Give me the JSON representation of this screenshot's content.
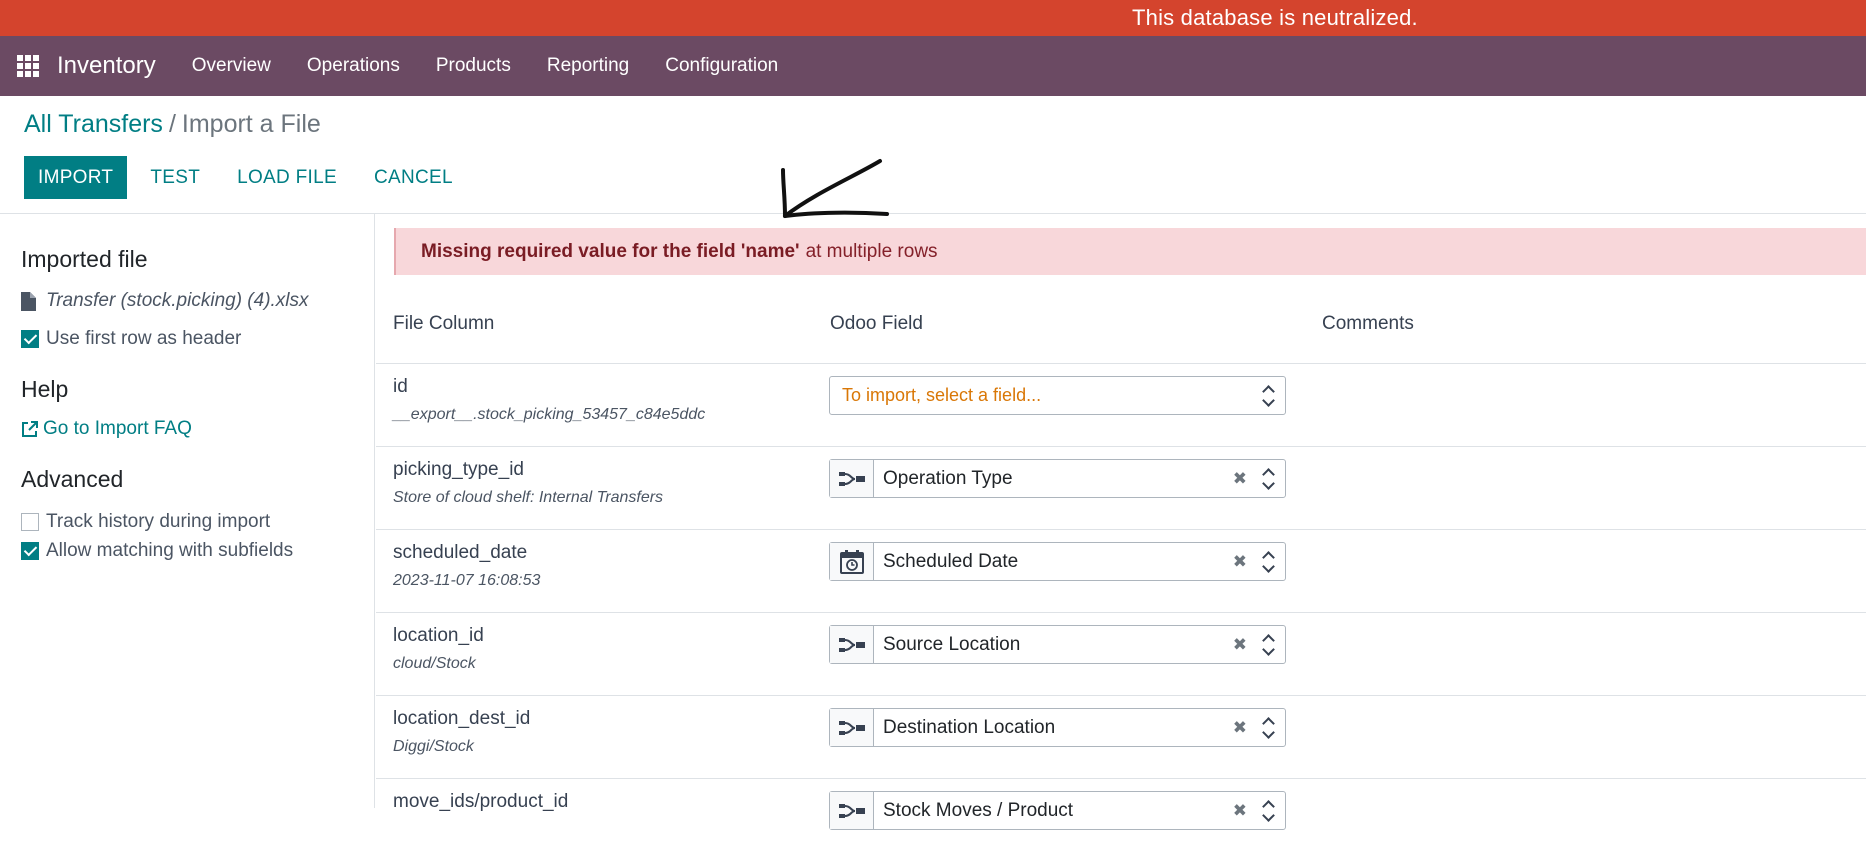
{
  "banner": {
    "text": "This database is neutralized."
  },
  "navbar": {
    "app_name": "Inventory",
    "menu": [
      "Overview",
      "Operations",
      "Products",
      "Reporting",
      "Configuration"
    ]
  },
  "breadcrumb": {
    "parent": "All Transfers",
    "separator": "/",
    "current": "Import a File"
  },
  "actions": {
    "import": "IMPORT",
    "test": "TEST",
    "load_file": "LOAD FILE",
    "cancel": "CANCEL"
  },
  "sidebar": {
    "imported_file_title": "Imported file",
    "file_name": "Transfer (stock.picking) (4).xlsx",
    "use_first_row_header": {
      "label": "Use first row as header",
      "checked": true
    },
    "help_title": "Help",
    "faq_link": "Go to Import FAQ",
    "advanced_title": "Advanced",
    "track_history": {
      "label": "Track history during import",
      "checked": false
    },
    "allow_matching": {
      "label": "Allow matching with subfields",
      "checked": true
    }
  },
  "alert": {
    "bold": "Missing required value for the field 'name'",
    "rest": "at multiple rows"
  },
  "table": {
    "headers": {
      "file_column": "File Column",
      "odoo_field": "Odoo Field",
      "comments": "Comments"
    },
    "rows": [
      {
        "name": "id",
        "sample": "__export__.stock_picking_53457_c84e5ddc",
        "placeholder": "To import, select a field..."
      },
      {
        "name": "picking_type_id",
        "sample": "Store of cloud shelf: Internal Transfers",
        "field": "Operation Type",
        "icon": "relation-icon"
      },
      {
        "name": "scheduled_date",
        "sample": "2023-11-07 16:08:53",
        "field": "Scheduled Date",
        "icon": "calendar-clock-icon"
      },
      {
        "name": "location_id",
        "sample": "cloud/Stock",
        "field": "Source Location",
        "icon": "relation-icon"
      },
      {
        "name": "location_dest_id",
        "sample": "Diggi/Stock",
        "field": "Destination Location",
        "icon": "relation-icon"
      },
      {
        "name": "move_ids/product_id",
        "sample": "",
        "field": "Stock Moves / Product",
        "icon": "relation-icon"
      }
    ]
  },
  "colors": {
    "banner": "#d4442d",
    "navbar": "#6b4a63",
    "primary": "#017e84",
    "alert_bg": "#f8d7da",
    "placeholder": "#d97706"
  }
}
